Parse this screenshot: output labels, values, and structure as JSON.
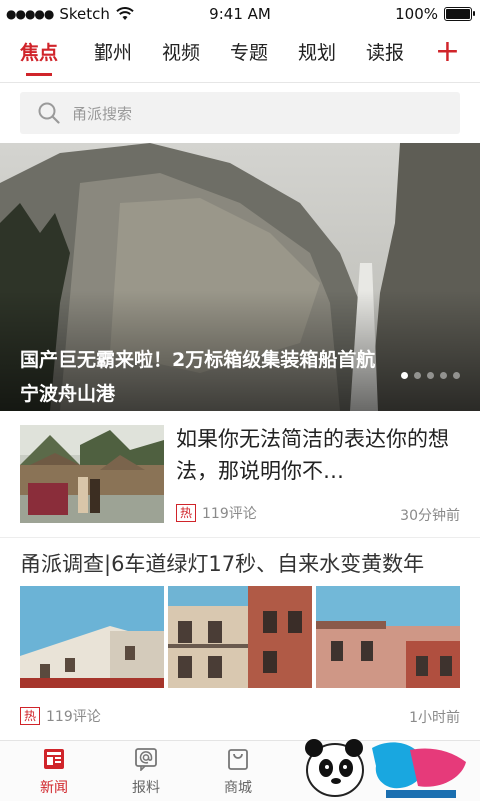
{
  "status_bar": {
    "dots": "●●●●●",
    "carrier": "Sketch",
    "time": "9:41 AM",
    "battery_text": "100%",
    "battery_level": 1.0
  },
  "tabs": [
    {
      "label": "焦点",
      "active": true
    },
    {
      "label": "鄞州",
      "active": false
    },
    {
      "label": "视频",
      "active": false
    },
    {
      "label": "专题",
      "active": false
    },
    {
      "label": "规划",
      "active": false
    },
    {
      "label": "读报",
      "active": false
    }
  ],
  "add_tab": "+",
  "search": {
    "placeholder": "甬派搜索"
  },
  "hero": {
    "title": "国产巨无霸来啦！2万标箱级集装箱船首航宁波舟山港",
    "page_count": 5,
    "current_page": 1
  },
  "news": [
    {
      "title": "如果你无法简洁的表达你的想法，那说明你不…",
      "hot": "热",
      "comments": "119评论",
      "time": "30分钟前"
    },
    {
      "title": "甬派调查|6车道绿灯17秒、自来水变黄数年",
      "hot": "热",
      "comments": "119评论",
      "time": "1小时前"
    }
  ],
  "bottom_nav": [
    {
      "label": "新闻",
      "icon": "newspaper-icon",
      "active": true
    },
    {
      "label": "报料",
      "icon": "at-sign-icon",
      "active": false
    },
    {
      "label": "商城",
      "icon": "shopping-bag-icon",
      "active": false
    }
  ],
  "colors": {
    "accent": "#d0242a",
    "text": "#222222",
    "muted": "#8a8a8a"
  }
}
